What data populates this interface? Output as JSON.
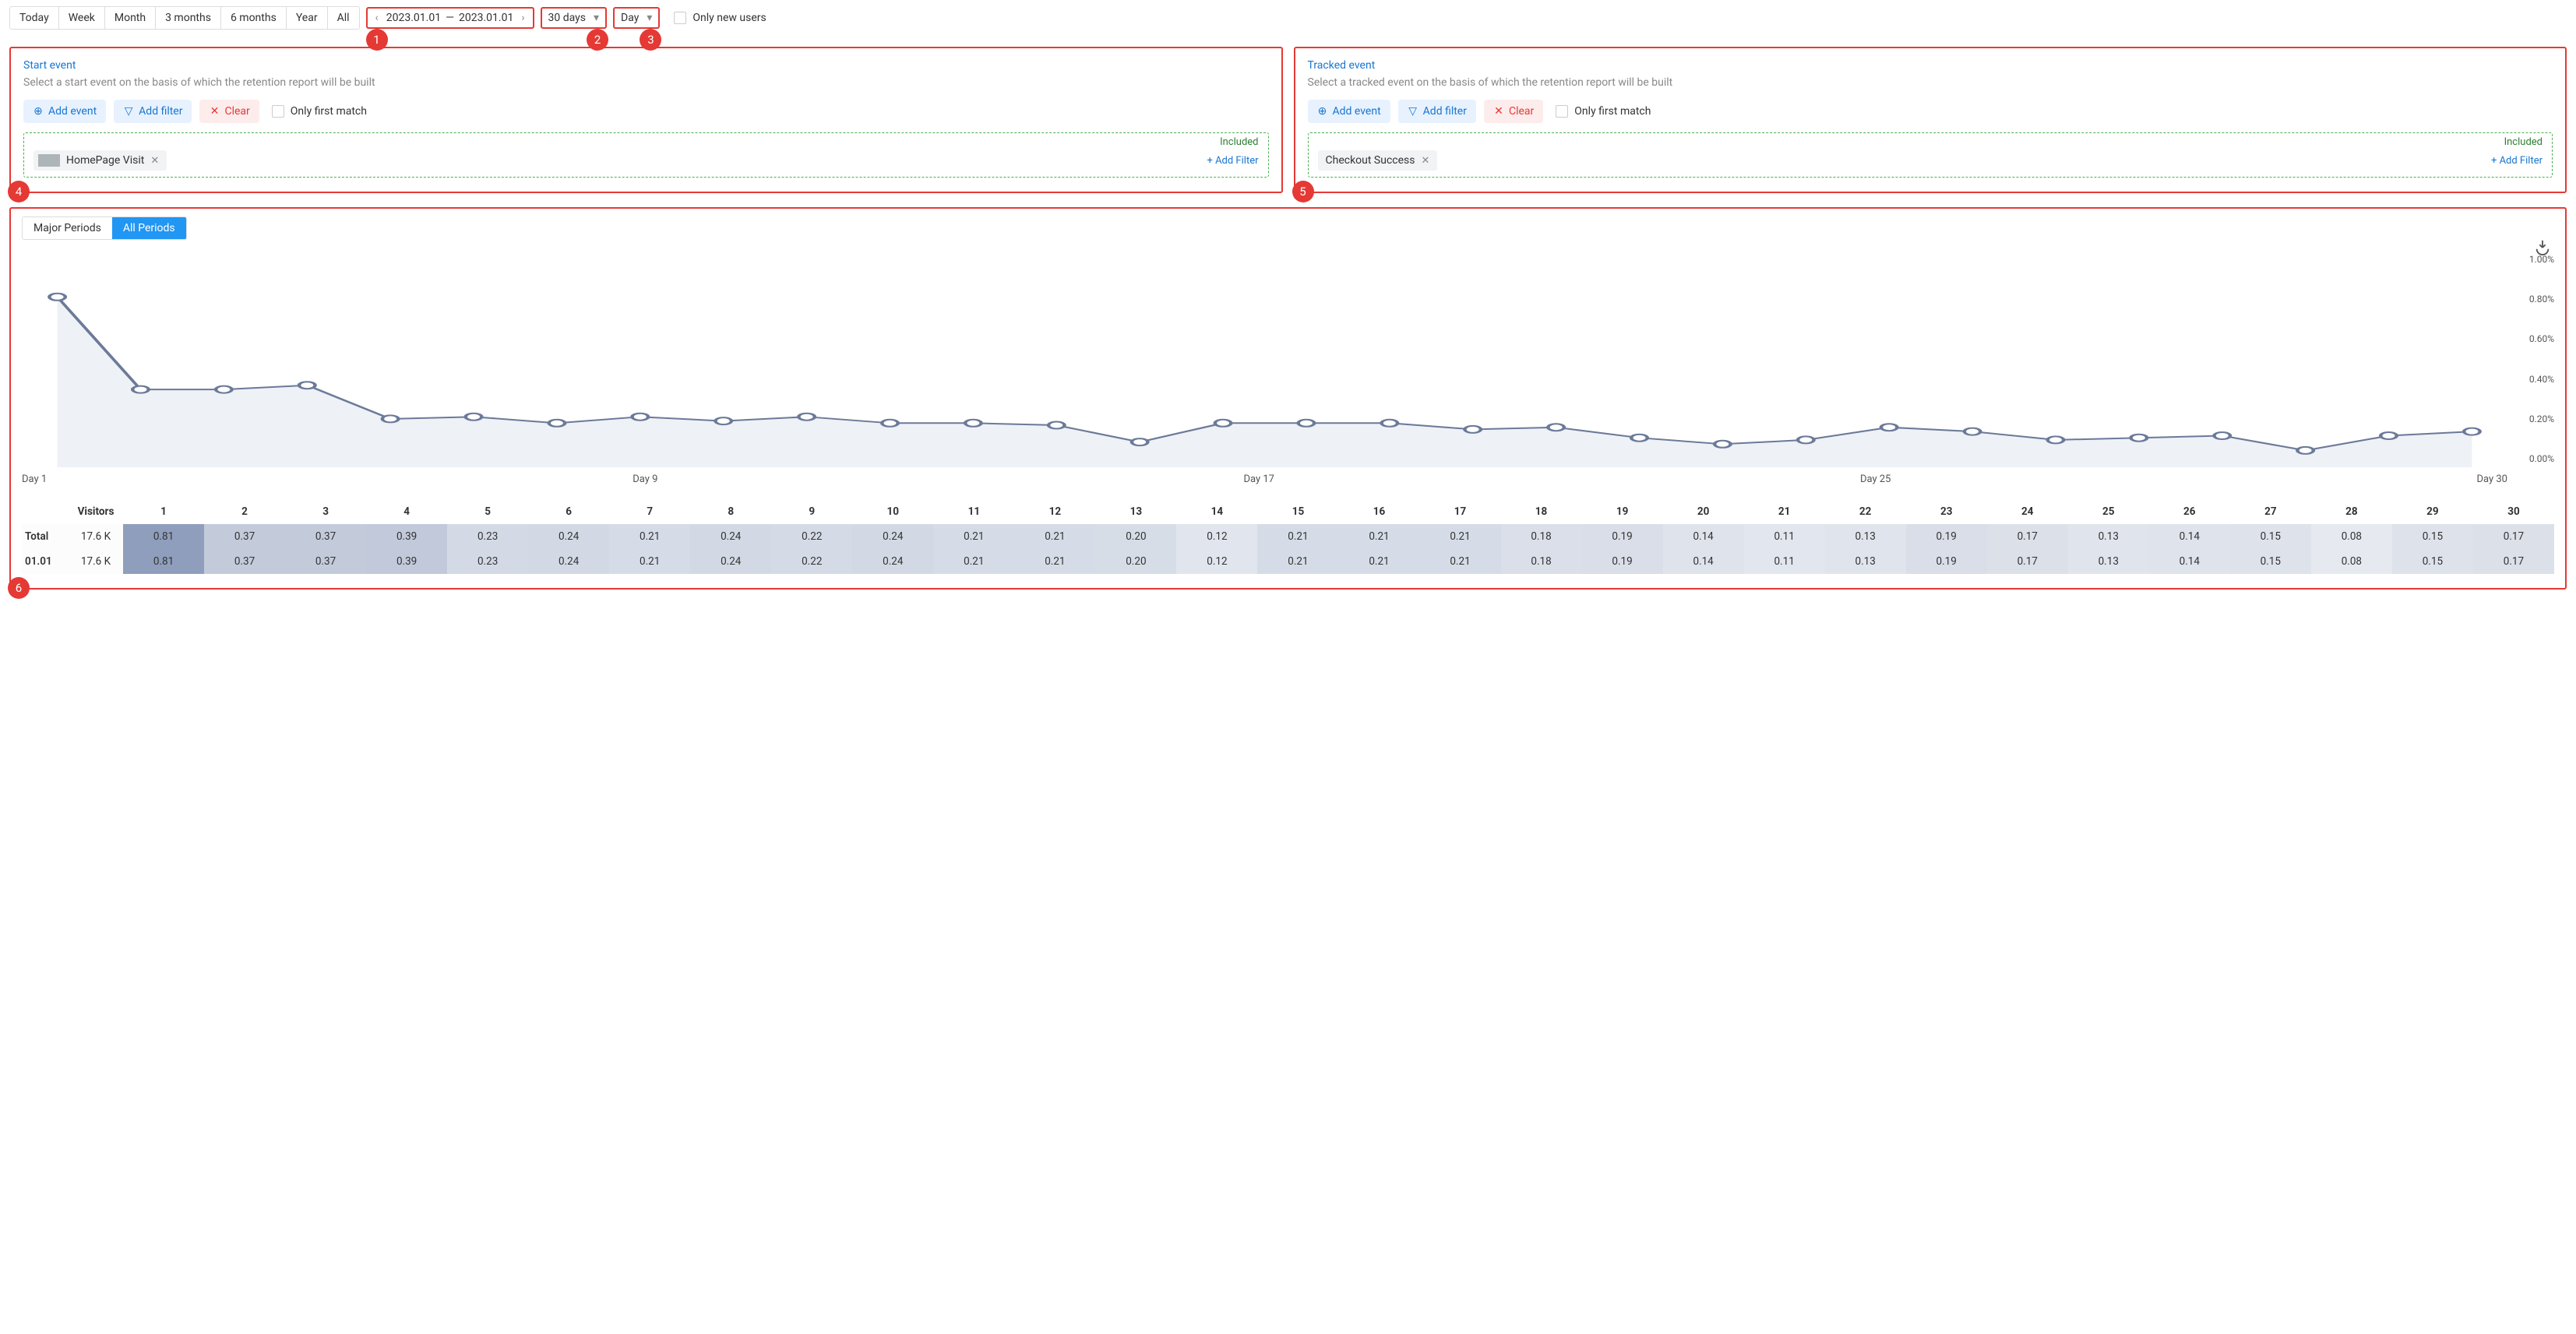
{
  "topbar": {
    "range_tabs": [
      "Today",
      "Week",
      "Month",
      "3 months",
      "6 months",
      "Year",
      "All"
    ],
    "date_start": "2023.01.01",
    "date_sep": "—",
    "date_end": "2023.01.01",
    "period_length": "30 days",
    "granularity": "Day",
    "only_new_users": "Only new users"
  },
  "callouts": {
    "b1": "1",
    "b2": "2",
    "b3": "3",
    "b4": "4",
    "b5": "5",
    "b6": "6"
  },
  "start_event": {
    "title": "Start event",
    "subtitle": "Select a start event on the basis of which the retention report will be built",
    "add_event": "Add event",
    "add_filter": "Add filter",
    "clear": "Clear",
    "only_first": "Only first match",
    "included": "Included",
    "chip_label": "HomePage Visit",
    "add_filter_link": "Add Filter"
  },
  "tracked_event": {
    "title": "Tracked event",
    "subtitle": "Select a tracked event on the basis of which the retention report will be built",
    "add_event": "Add event",
    "add_filter": "Add filter",
    "clear": "Clear",
    "only_first": "Only first match",
    "included": "Included",
    "chip_label": "Checkout Success",
    "add_filter_link": "Add Filter"
  },
  "periods": {
    "major": "Major Periods",
    "all": "All Periods"
  },
  "chart_data": {
    "type": "line",
    "title": "",
    "xlabel": "",
    "ylabel": "",
    "ylim": [
      0,
      1.0
    ],
    "y_ticks": [
      "1.00%",
      "0.80%",
      "0.60%",
      "0.40%",
      "0.20%",
      "0.00%"
    ],
    "x_tick_labels": [
      "Day 1",
      "Day 9",
      "Day 17",
      "Day 25",
      "Day 30"
    ],
    "x": [
      1,
      2,
      3,
      4,
      5,
      6,
      7,
      8,
      9,
      10,
      11,
      12,
      13,
      14,
      15,
      16,
      17,
      18,
      19,
      20,
      21,
      22,
      23,
      24,
      25,
      26,
      27,
      28,
      29,
      30
    ],
    "series": [
      {
        "name": "Total",
        "values": [
          0.81,
          0.37,
          0.37,
          0.39,
          0.23,
          0.24,
          0.21,
          0.24,
          0.22,
          0.24,
          0.21,
          0.21,
          0.2,
          0.12,
          0.21,
          0.21,
          0.21,
          0.18,
          0.19,
          0.14,
          0.11,
          0.13,
          0.19,
          0.17,
          0.13,
          0.14,
          0.15,
          0.08,
          0.15,
          0.17
        ]
      }
    ]
  },
  "table": {
    "visitors_header": "Visitors",
    "day_headers": [
      "1",
      "2",
      "3",
      "4",
      "5",
      "6",
      "7",
      "8",
      "9",
      "10",
      "11",
      "12",
      "13",
      "14",
      "15",
      "16",
      "17",
      "18",
      "19",
      "20",
      "21",
      "22",
      "23",
      "24",
      "25",
      "26",
      "27",
      "28",
      "29",
      "30"
    ],
    "rows": [
      {
        "label": "Total",
        "visitors": "17.6 K",
        "values": [
          0.81,
          0.37,
          0.37,
          0.39,
          0.23,
          0.24,
          0.21,
          0.24,
          0.22,
          0.24,
          0.21,
          0.21,
          0.2,
          0.12,
          0.21,
          0.21,
          0.21,
          0.18,
          0.19,
          0.14,
          0.11,
          0.13,
          0.19,
          0.17,
          0.13,
          0.14,
          0.15,
          0.08,
          0.15,
          0.17
        ]
      },
      {
        "label": "01.01",
        "visitors": "17.6 K",
        "values": [
          0.81,
          0.37,
          0.37,
          0.39,
          0.23,
          0.24,
          0.21,
          0.24,
          0.22,
          0.24,
          0.21,
          0.21,
          0.2,
          0.12,
          0.21,
          0.21,
          0.21,
          0.18,
          0.19,
          0.14,
          0.11,
          0.13,
          0.19,
          0.17,
          0.13,
          0.14,
          0.15,
          0.08,
          0.15,
          0.17
        ]
      }
    ]
  }
}
